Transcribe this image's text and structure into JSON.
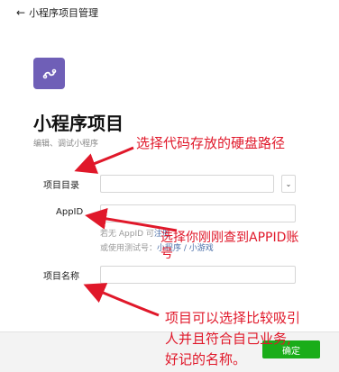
{
  "header": {
    "back_label": "小程序项目管理"
  },
  "logo": {
    "icon": "miniprogram-logo-icon",
    "color": "#6f5fb7"
  },
  "page": {
    "title": "小程序项目",
    "subtitle": "编辑、调试小程序"
  },
  "form": {
    "project_dir_label": "项目目录",
    "project_dir_value": "",
    "appid_label": "AppID",
    "appid_value": "",
    "appid_hint_prefix": "若无 AppID 可",
    "appid_hint_link": "注册",
    "appid_hint2_prefix": "或使用测试号：",
    "appid_hint2_link": "小程序 / 小游戏",
    "project_name_label": "项目名称",
    "project_name_value": ""
  },
  "annotations": {
    "a1": "选择代码存放的硬盘路径",
    "a2_line1": "选择你刚刚查到APPID账",
    "a2_line2": "号",
    "a3_line1": "项目可以选择比较吸引",
    "a3_line2": "人并且符合自己业务,",
    "a3_line3": "好记的名称。"
  },
  "footer": {
    "confirm_label": "确定"
  },
  "colors": {
    "accent": "#1aad19",
    "annotation": "#e0182a"
  }
}
